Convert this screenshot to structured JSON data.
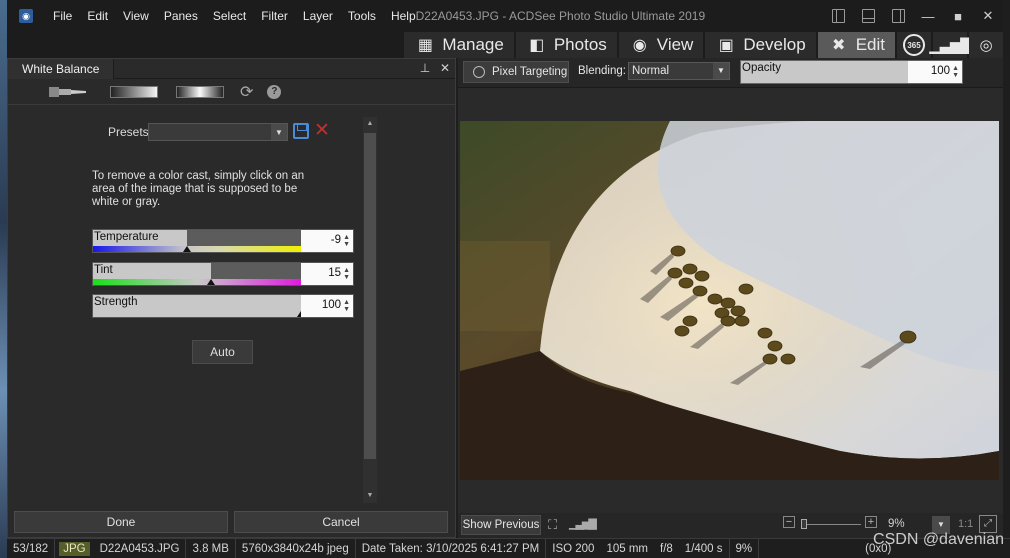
{
  "app": {
    "window_title": "D22A0453.JPG - ACDSee Photo Studio Ultimate 2019",
    "menu": [
      "File",
      "Edit",
      "View",
      "Panes",
      "Select",
      "Filter",
      "Layer",
      "Tools",
      "Help"
    ]
  },
  "modes": [
    {
      "label": "Manage",
      "icon": "grid-icon"
    },
    {
      "label": "Photos",
      "icon": "photos-icon"
    },
    {
      "label": "View",
      "icon": "eye-icon"
    },
    {
      "label": "Develop",
      "icon": "develop-icon"
    },
    {
      "label": "Edit",
      "icon": "edit-tools-icon",
      "active": true
    }
  ],
  "mode_extra": {
    "circle_text": "365"
  },
  "panel": {
    "title": "White Balance",
    "presets_label": "Presets",
    "presets_value": "",
    "hint": "To remove a color cast, simply click on an area of the image that is supposed to be white or gray.",
    "sliders": [
      {
        "label": "Temperature",
        "value": "-9",
        "level": 0.45
      },
      {
        "label": "Tint",
        "value": "15",
        "level": 0.57
      },
      {
        "label": "Strength",
        "value": "100",
        "level": 1.0
      }
    ],
    "auto_label": "Auto",
    "done_label": "Done",
    "cancel_label": "Cancel"
  },
  "image_toolbar": {
    "pixel_targeting": "Pixel Targeting",
    "blending_label": "Blending:",
    "blending_value": "Normal",
    "opacity_label": "Opacity",
    "opacity_value": "100"
  },
  "image_bottom": {
    "show_previous": "Show Previous",
    "zoom": "9%",
    "one_to_one": "1:1"
  },
  "status": {
    "index": "53/182",
    "type": "JPG",
    "filename": "D22A0453.JPG",
    "size": "3.8 MB",
    "dimensions": "5760x3840x24b jpeg",
    "date_taken": "Date Taken: 3/10/2025 6:41:27 PM",
    "iso": "ISO 200",
    "focal": "105 mm",
    "aperture": "f/8",
    "shutter": "1/400 s",
    "zoom": "9%",
    "coords": "(0x0)"
  },
  "watermark": "CSDN @davenian",
  "colors": {
    "accent": "#5a5a5a",
    "temp_gradient": [
      "#2020e0",
      "#f0f000"
    ],
    "tint_gradient": [
      "#20d020",
      "#e020e0"
    ]
  }
}
